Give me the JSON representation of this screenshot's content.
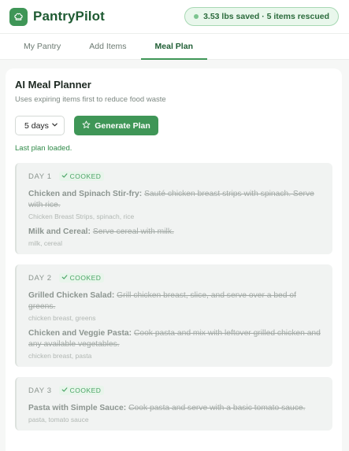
{
  "app": {
    "name": "PantryPilot",
    "savings_badge": "3.53 lbs saved · 5 items rescued"
  },
  "tabs": [
    {
      "label": "My Pantry"
    },
    {
      "label": "Add Items"
    },
    {
      "label": "Meal Plan",
      "active": true
    }
  ],
  "planner": {
    "title": "AI Meal Planner",
    "subtitle": "Uses expiring items first to reduce food waste",
    "days_select": "5 days",
    "generate_label": "Generate Plan",
    "status": "Last plan loaded."
  },
  "days": [
    {
      "label": "DAY 1",
      "badge": "COOKED",
      "meals": [
        {
          "name": "Chicken and Spinach Stir-fry:",
          "description": "Sauté chicken breast strips with spinach. Serve with rice.",
          "ingredients": "Chicken Breast Strips, spinach, rice"
        },
        {
          "name": "Milk and Cereal:",
          "description": "Serve cereal with milk.",
          "ingredients": "milk, cereal"
        }
      ]
    },
    {
      "label": "DAY 2",
      "badge": "COOKED",
      "meals": [
        {
          "name": "Grilled Chicken Salad:",
          "description": "Grill chicken breast, slice, and serve over a bed of greens.",
          "ingredients": "chicken breast, greens"
        },
        {
          "name": "Chicken and Veggie Pasta:",
          "description": "Cook pasta and mix with leftover grilled chicken and any available vegetables.",
          "ingredients": "chicken breast, pasta"
        }
      ]
    },
    {
      "label": "DAY 3",
      "badge": "COOKED",
      "meals": [
        {
          "name": "Pasta with Simple Sauce:",
          "description": "Cook pasta and serve with a basic tomato sauce.",
          "ingredients": "pasta, tomato sauce"
        }
      ]
    }
  ],
  "colors": {
    "accent": "#3f9657",
    "brand_text": "#1e5a32",
    "badge_bg": "#e9f7ec",
    "cooked_text": "#4aa565"
  },
  "icons": {
    "logo": "chef-hat-icon",
    "generate": "star-icon",
    "select": "chevron-down-icon",
    "cooked": "checkmark-icon"
  }
}
